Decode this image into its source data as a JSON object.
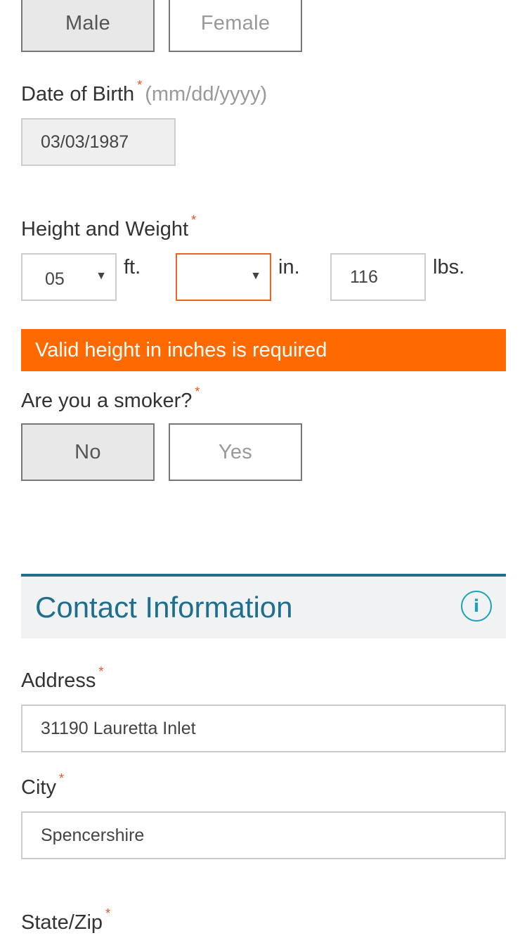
{
  "gender": {
    "options": [
      "Male",
      "Female"
    ],
    "selected": "Male"
  },
  "dob": {
    "label": "Date of Birth",
    "required_mark": "*",
    "hint": "(mm/dd/yyyy)",
    "value": "03/03/1987"
  },
  "height_weight": {
    "label": "Height and Weight",
    "required_mark": "*",
    "feet_value": "05",
    "feet_unit": "ft.",
    "inches_value": "",
    "inches_unit": "in.",
    "weight_value": "116",
    "weight_unit": "lbs.",
    "error_color": "#ff6a00"
  },
  "error_message": "Valid height in inches is required",
  "smoker": {
    "label": "Are you a smoker?",
    "required_mark": "*",
    "options": [
      "No",
      "Yes"
    ],
    "selected": "No"
  },
  "contact_section": {
    "title": "Contact Information",
    "info_icon": "i",
    "accent_color": "#1f6e8c"
  },
  "address": {
    "label": "Address",
    "required_mark": "*",
    "value": "31190 Lauretta Inlet"
  },
  "city": {
    "label": "City",
    "required_mark": "*",
    "value": "Spencershire"
  },
  "state_zip": {
    "label": "State/Zip",
    "required_mark": "*"
  }
}
